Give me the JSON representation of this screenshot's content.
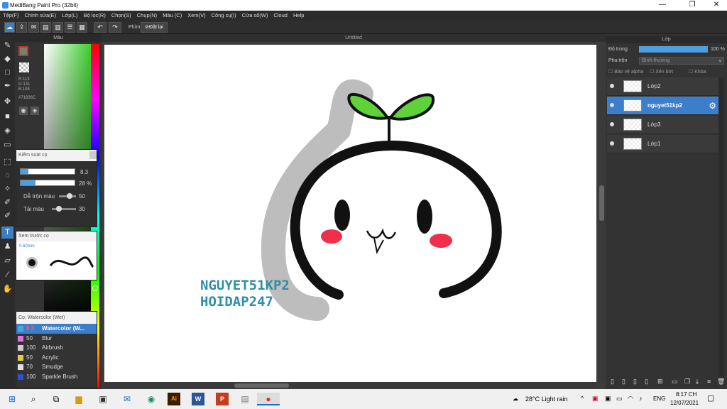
{
  "window": {
    "title": "MediBang Paint Pro (32bit)",
    "controls": [
      "—",
      "❐",
      "✕"
    ]
  },
  "menu": [
    "Tệp(F)",
    "Chỉnh sửa(E)",
    "Lớp(L)",
    "Bộ lọc(R)",
    "Chọn(S)",
    "Chụp(N)",
    "Màu (C)",
    "Xem(V)",
    "Công cụ(I)",
    "Cửa sổ(W)",
    "Cloud",
    "Help"
  ],
  "toolbar": {
    "phim_label": "Phím",
    "dat_lai_label": "Đặt lại"
  },
  "document": {
    "title": "Untitled"
  },
  "color_panel": {
    "header": "Màu",
    "rgb": {
      "r": "R:113",
      "g": "G:131",
      "b": "B:108"
    },
    "hex": "#71836C"
  },
  "brush_control": {
    "header": "Kiểm soát cọ",
    "size": "8.3",
    "opacity": "28",
    "opacity_unit": "%",
    "blend_label": "Dễ trộn màu",
    "blend_value": "50",
    "reload_label": "Tải màu",
    "reload_value": "30"
  },
  "brush_preview": {
    "header": "Xem trước cọ",
    "size_label": "0.60mm"
  },
  "brush_list": {
    "header": "Cọ: Watercolor (Wet)",
    "items": [
      {
        "size": "8.3",
        "name": "Watercolor (W...",
        "color": "#4fa3e0"
      },
      {
        "size": "50",
        "name": "Blur",
        "color": "#e06fe0"
      },
      {
        "size": "100",
        "name": "Airbrush",
        "color": "#cccccc"
      },
      {
        "size": "50",
        "name": "Acrylic",
        "color": "#e0d040"
      },
      {
        "size": "70",
        "name": "Smudge",
        "color": "#e0e0e0"
      },
      {
        "size": "100",
        "name": "Sparkle Brush",
        "color": "#3050d0"
      }
    ]
  },
  "layer_panel": {
    "header": "Lớp",
    "opacity_label": "Độ trong",
    "opacity_value": "100 %",
    "blend_label": "Pha trộn",
    "blend_value": "Bình thường",
    "protect_alpha": "Bảo vệ alpha",
    "clip": "Xén bớt",
    "lock": "Khóa",
    "layers": [
      {
        "name": "Lớp2",
        "selected": false
      },
      {
        "name": "nguyet51kp2",
        "selected": true
      },
      {
        "name": "Lớp3",
        "selected": false
      },
      {
        "name": "Lớp1",
        "selected": false
      }
    ]
  },
  "canvas_text": {
    "line1": "NGUYET51KP2",
    "line2": "HOIDAP247"
  },
  "taskbar": {
    "weather": "28°C  Light rain",
    "lang": "ENG",
    "time": "8:17 CH",
    "date": "12/07/2021"
  },
  "colors": {
    "accent": "#3d7ecb",
    "sprout_green": "#5fd23a",
    "blush": "#f0304a",
    "watermark_teal": "#2f8fa8"
  }
}
